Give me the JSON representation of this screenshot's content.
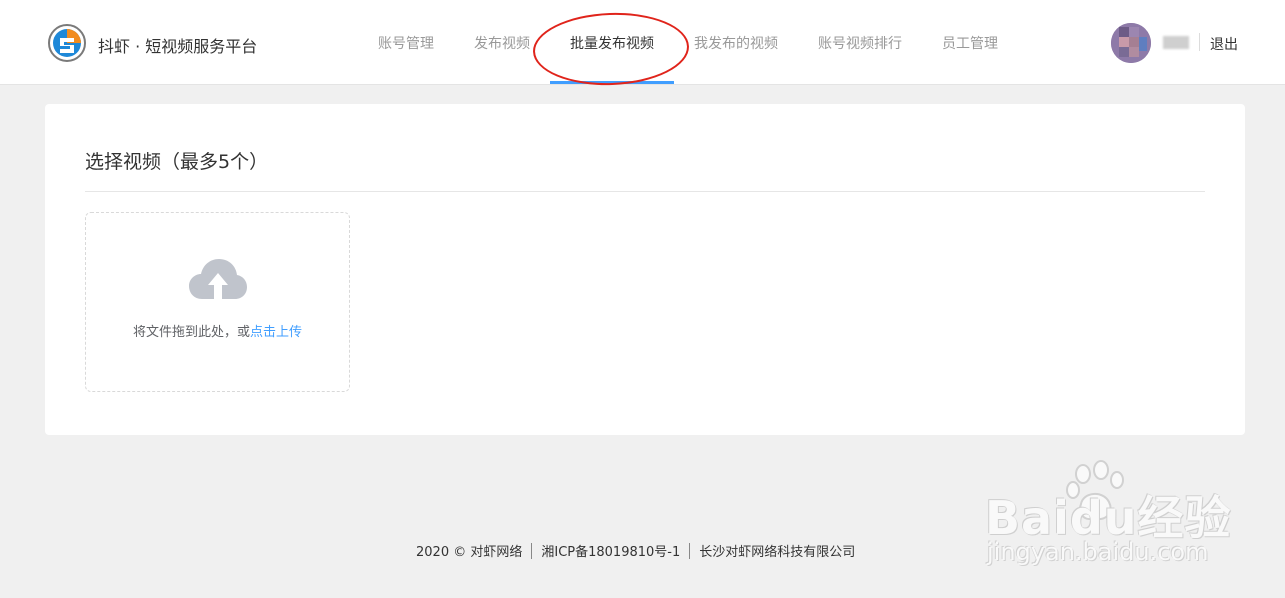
{
  "header": {
    "brand": "抖虾 · 短视频服务平台",
    "logout": "退出"
  },
  "nav": {
    "tabs": [
      {
        "label": "账号管理",
        "active": false
      },
      {
        "label": "发布视频",
        "active": false
      },
      {
        "label": "批量发布视频",
        "active": true
      },
      {
        "label": "我发布的视频",
        "active": false
      },
      {
        "label": "账号视频排行",
        "active": false
      },
      {
        "label": "员工管理",
        "active": false
      }
    ]
  },
  "card": {
    "title": "选择视频（最多5个）",
    "upload_text": "将文件拖到此处，或",
    "upload_link": "点击上传"
  },
  "footer": {
    "copyright": "2020 © 对虾网络",
    "icp": "湘ICP备18019810号-1",
    "company": "长沙对虾网络科技有限公司"
  },
  "watermark": {
    "brand": "Baidu经验",
    "url": "jingyan.baidu.com"
  },
  "colors": {
    "accent": "#409eff",
    "annotation": "#e0241b",
    "page_bg": "#f0f0f0"
  },
  "icons": [
    "logo-icon",
    "avatar",
    "cloud-upload-icon",
    "paw-icon"
  ]
}
